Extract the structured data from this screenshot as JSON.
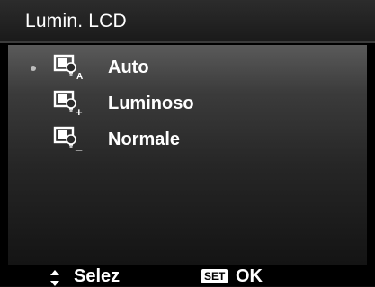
{
  "title": "Lumin. LCD",
  "menu": {
    "selected_index": 0,
    "items": [
      {
        "label": "Auto",
        "icon": "lcd-brightness-auto-icon",
        "icon_mark": "A",
        "selected": true
      },
      {
        "label": "Luminoso",
        "icon": "lcd-brightness-bright-icon",
        "icon_mark": "+",
        "selected": false
      },
      {
        "label": "Normale",
        "icon": "lcd-brightness-normal-icon",
        "icon_mark": "_",
        "selected": false
      }
    ]
  },
  "footer": {
    "select_icon": "up-down-arrows-icon",
    "select_label": "Selez",
    "set_badge": "SET",
    "ok_label": "OK"
  },
  "colors": {
    "text": "#ffffff",
    "bullet": "#bdbdbd",
    "title_bar": "#222222",
    "background": "#000000"
  }
}
